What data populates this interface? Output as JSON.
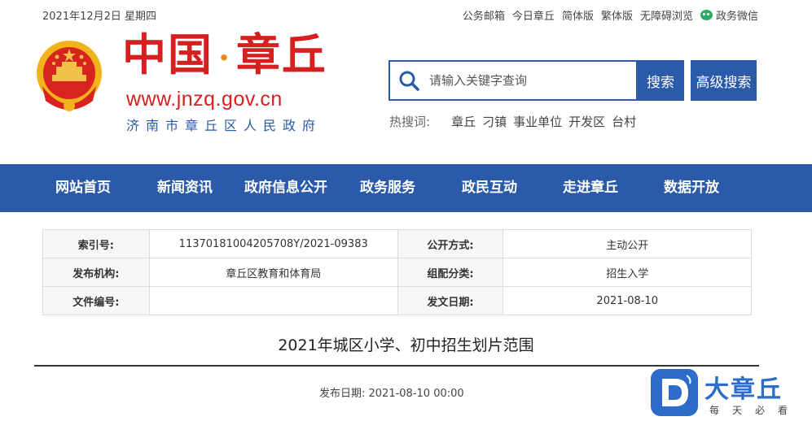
{
  "topbar": {
    "date": "2021年12月2日 星期四",
    "links": [
      "公务邮箱",
      "今日章丘",
      "简体版",
      "繁体版",
      "无障碍浏览"
    ],
    "wechat_label": "政务微信"
  },
  "header": {
    "site_name_left": "中国",
    "site_name_right": "章丘",
    "url": "www.jnzq.gov.cn",
    "subtitle": "济南市章丘区人民政府"
  },
  "search": {
    "placeholder": "请输入关键字查询",
    "button": "搜索",
    "advanced_button": "高级搜索",
    "hot_label": "热搜词:",
    "hot_words": [
      "章丘",
      "刁镇",
      "事业单位",
      "开发区",
      "台村"
    ]
  },
  "nav": [
    "网站首页",
    "新闻资讯",
    "政府信息公开",
    "政务服务",
    "政民互动",
    "走进章丘",
    "数据开放"
  ],
  "info": {
    "rows": [
      [
        {
          "k": "索引号:",
          "v": "11370181004205708Y/2021-09383"
        },
        {
          "k": "公开方式:",
          "v": "主动公开"
        }
      ],
      [
        {
          "k": "发布机构:",
          "v": "章丘区教育和体育局"
        },
        {
          "k": "组配分类:",
          "v": "招生入学"
        }
      ],
      [
        {
          "k": "文件编号:",
          "v": ""
        },
        {
          "k": "发文日期:",
          "v": "2021-08-10"
        }
      ]
    ]
  },
  "article": {
    "title": "2021年城区小学、初中招生划片范围",
    "pubdate": "发布日期: 2021-08-10 00:00"
  },
  "watermark": {
    "brand": "大章丘",
    "slogan": "每天必看"
  },
  "colors": {
    "primary": "#2a5aa8",
    "logo_red": "#d61f1f",
    "watermark_blue": "#2e6cc9"
  }
}
